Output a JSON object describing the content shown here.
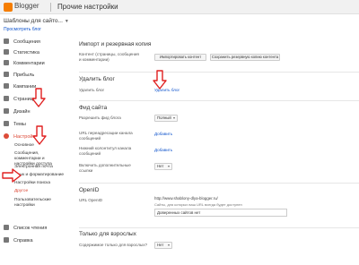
{
  "header": {
    "app_name": "Blogger",
    "page_title": "Прочие настройки"
  },
  "sidebar": {
    "blog_name": "Шаблоны для сайто...",
    "view_blog": "Просмотреть блог",
    "items": [
      {
        "label": "Сообщения"
      },
      {
        "label": "Статистика"
      },
      {
        "label": "Комментарии"
      },
      {
        "label": "Прибыль"
      },
      {
        "label": "Кампании"
      },
      {
        "label": "Страницы"
      },
      {
        "label": "Дизайн"
      },
      {
        "label": "Темы"
      },
      {
        "label": "Настройки"
      },
      {
        "label": "Список чтения"
      },
      {
        "label": "Справка"
      }
    ],
    "sub_items": [
      {
        "label": "Основное"
      },
      {
        "label": "Сообщения, комментарии и настройки доступа"
      },
      {
        "label": "Электронная почта"
      },
      {
        "label": "Язык и форматирование"
      },
      {
        "label": "Настройки поиска"
      },
      {
        "label": "Другое"
      },
      {
        "label": "Пользовательские настройки"
      }
    ]
  },
  "main": {
    "import": {
      "title": "Импорт и резервная копия",
      "row_label": "Контент (страницы, сообщения и комментарии)",
      "import_button": "Импортировать контент",
      "backup_button": "Сохранить резервную копию контента"
    },
    "delete": {
      "title": "Удалить блог",
      "row_label": "Удалить блог",
      "link": "Удалить блог"
    },
    "feed": {
      "title": "Фид сайта",
      "allow_label": "Разрешить фид блога",
      "allow_value": "Полный",
      "redirect_label": "URL переадресации канала сообщений",
      "redirect_link": "Добавить",
      "footer_label": "Нижний колонтитул канала сообщений",
      "footer_link": "Добавить",
      "attach_label": "Включить дополнительные ссылки",
      "attach_value": "Нет"
    },
    "openid": {
      "title": "OpenID",
      "url_label": "URL OpenID",
      "url_value": "http://www.shablony-dlya-blogger.ru/",
      "hint": "Сайты, для которых ваш URL всегда будет доступен",
      "trusted_value": "Доверенных сайтов нет"
    },
    "adult": {
      "title": "Только для взрослых",
      "row_label": "Содержимое только для взрослых?",
      "value": "Нет"
    }
  },
  "colors": {
    "accent": "#dd4b39",
    "link": "#1155cc",
    "logo": "#f57d00"
  }
}
